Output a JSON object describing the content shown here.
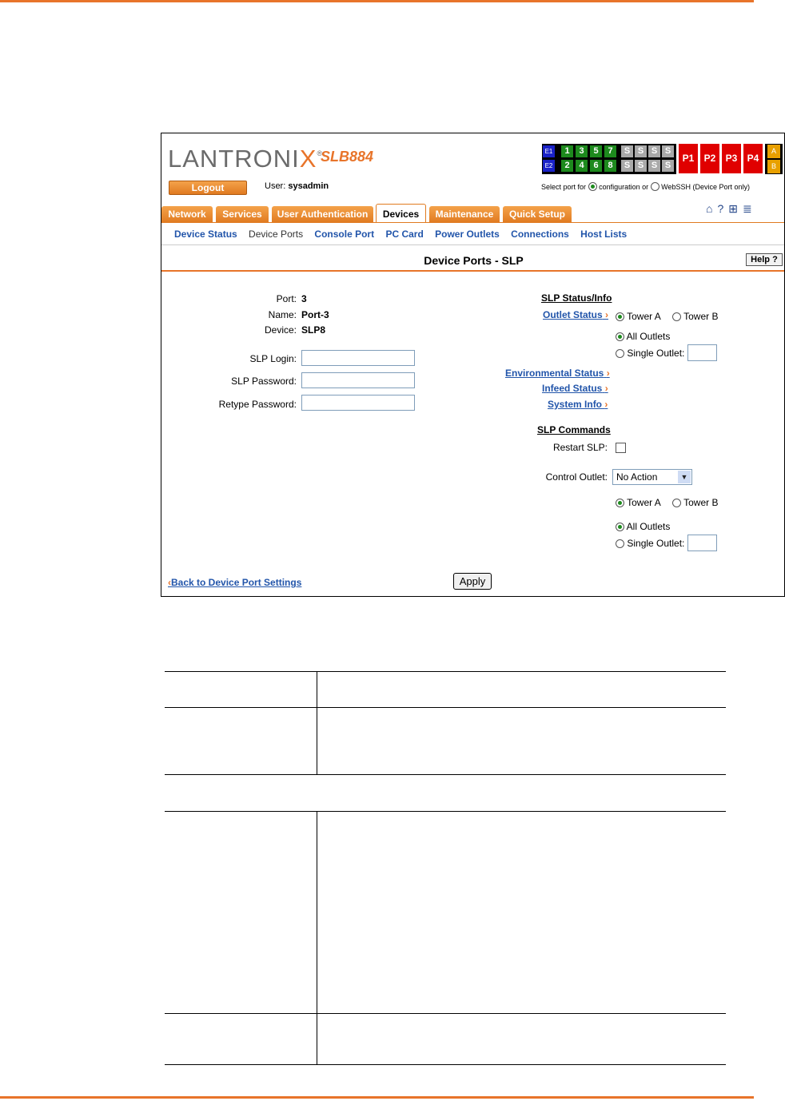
{
  "brand": {
    "logo": "LANTRONIX",
    "logo_x": "X",
    "registered": "®",
    "model": "SLB884"
  },
  "header": {
    "logout_label": "Logout",
    "user_prefix": "User:",
    "user_name": "sysadmin"
  },
  "ports": {
    "e_labels": [
      "E1",
      "E2"
    ],
    "top_row": [
      "1",
      "3",
      "5",
      "7",
      "S",
      "S",
      "S",
      "S"
    ],
    "bottom_row": [
      "2",
      "4",
      "6",
      "8",
      "S",
      "S",
      "S",
      "S"
    ],
    "power": [
      "P1",
      "P2",
      "P3",
      "P4"
    ],
    "ab": [
      "A",
      "B"
    ],
    "select_prefix": "Select port for",
    "config_label": "configuration or",
    "webssh_label": "WebSSH (Device Port only)"
  },
  "tabs": [
    "Network",
    "Services",
    "User Authentication",
    "Devices",
    "Maintenance",
    "Quick Setup"
  ],
  "subnav": [
    "Device Status",
    "Device Ports",
    "Console Port",
    "PC Card",
    "Power Outlets",
    "Connections",
    "Host Lists"
  ],
  "page": {
    "title": "Device Ports - SLP",
    "help": "Help"
  },
  "info": {
    "port_label": "Port:",
    "port_value": "3",
    "name_label": "Name:",
    "name_value": "Port-3",
    "device_label": "Device:",
    "device_value": "SLP8"
  },
  "form": {
    "login_label": "SLP Login:",
    "password_label": "SLP Password:",
    "retype_label": "Retype Password:"
  },
  "status": {
    "heading": "SLP Status/Info",
    "outlet_status": "Outlet Status",
    "tower_a": "Tower A",
    "tower_b": "Tower B",
    "all_outlets": "All Outlets",
    "single_outlet": "Single Outlet:",
    "environmental": "Environmental Status",
    "infeed": "Infeed Status",
    "system_info": "System Info"
  },
  "commands": {
    "heading": "SLP Commands",
    "restart_label": "Restart SLP:",
    "control_label": "Control Outlet:",
    "control_value": "No Action",
    "tower_a": "Tower A",
    "tower_b": "Tower B",
    "all_outlets": "All Outlets",
    "single_outlet": "Single Outlet:"
  },
  "footer": {
    "back_link": "Back to Device Port Settings",
    "apply": "Apply"
  }
}
